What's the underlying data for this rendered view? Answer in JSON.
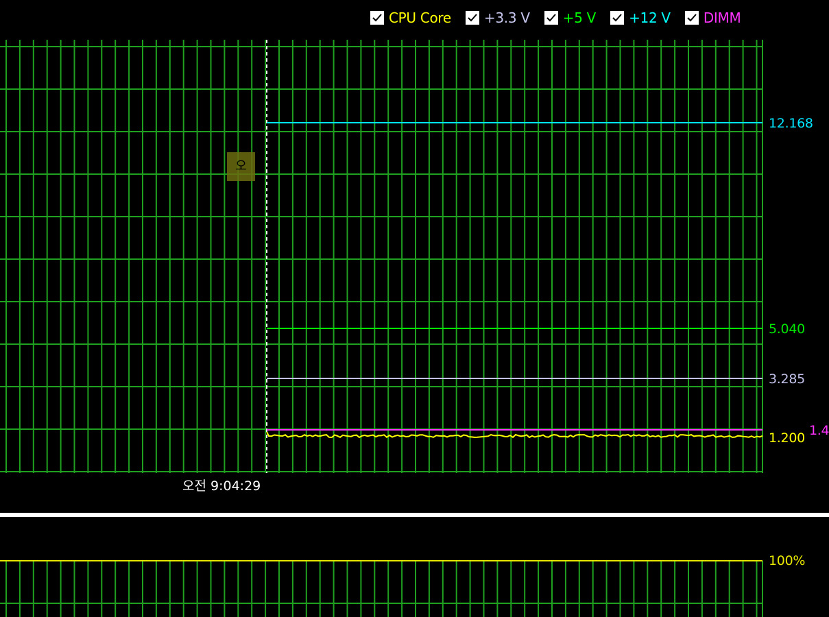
{
  "legend": [
    {
      "label": "CPU Core",
      "color": "#ffff00",
      "checked": true
    },
    {
      "label": "+3.3 V",
      "color": "#c8c8f0",
      "checked": true
    },
    {
      "label": "+5 V",
      "color": "#00ff00",
      "checked": true
    },
    {
      "label": "+12 V",
      "color": "#00ffff",
      "checked": true
    },
    {
      "label": "DIMM",
      "color": "#ff33ff",
      "checked": true
    }
  ],
  "values": {
    "v12": "12.168",
    "v5": "5.040",
    "v33": "3.285",
    "dimm": "1.4",
    "cpu": "1.200"
  },
  "time": {
    "period": "오전",
    "clock": "9:04:29"
  },
  "tooltip_glyph": "오",
  "lower": {
    "label": "100%",
    "value": 100
  },
  "colors": {
    "grid": "#1fa01f",
    "background": "#000000",
    "cursor": "#ffffff",
    "divider": "#ffffff"
  }
}
